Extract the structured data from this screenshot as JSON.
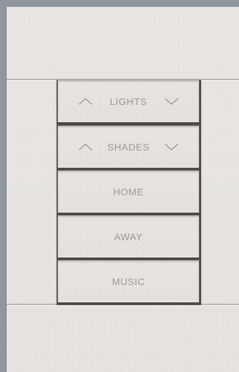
{
  "keypad": {
    "buttons": [
      {
        "label": "LIGHTS",
        "up_icon": "chevron-up-icon",
        "down_icon": "chevron-down-icon"
      },
      {
        "label": "SHADES",
        "up_icon": "chevron-up-icon",
        "down_icon": "chevron-down-icon"
      },
      {
        "label": "HOME"
      },
      {
        "label": "AWAY"
      },
      {
        "label": "MUSIC"
      }
    ]
  },
  "colors": {
    "background": "#8f969e",
    "panel": "#e6e3e0",
    "key_face": "#e5e2df",
    "key_frame": "#4f4b47",
    "label": "#9a9794"
  }
}
